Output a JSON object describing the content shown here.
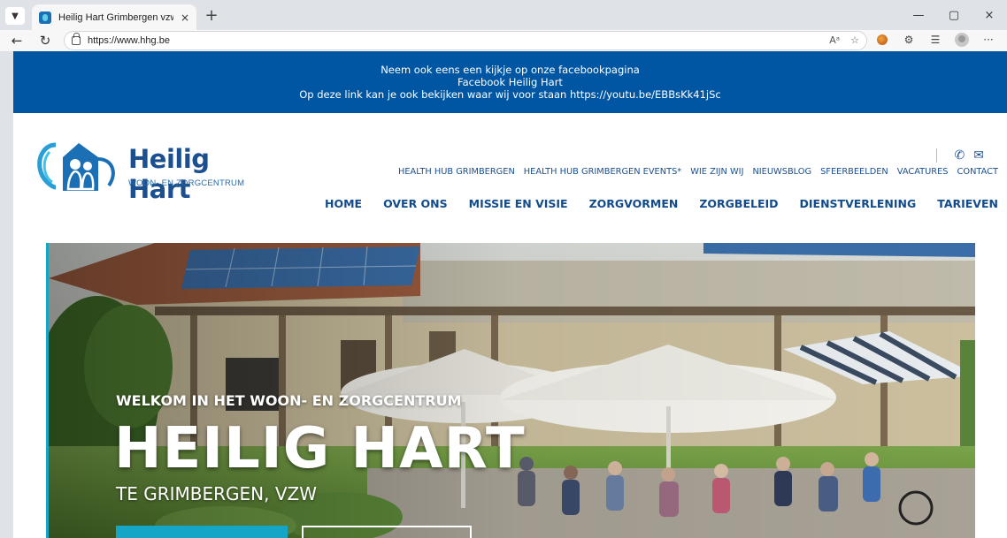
{
  "browser": {
    "tab_title": "Heilig Hart Grimbergen vzw | Wo...",
    "tab_close": "×",
    "new_tab": "+",
    "url": "https://www.hhg.be",
    "window": {
      "minimize": "—",
      "restore": "▢",
      "close": "×"
    },
    "read_aloud": "Aᵃ",
    "more": "···"
  },
  "banner": {
    "line1": "Neem ook eens een kijkje op onze facebookpagina",
    "line2": "Facebook Heilig Hart",
    "line3": "Op deze link kan je ook bekijken waar wij voor staan https://youtu.be/EBBsKk41jSc"
  },
  "logo": {
    "name": "Heilig Hart",
    "subtitle": "WOON- EN ZORGCENTRUM"
  },
  "contact_icons": {
    "phone": "✆",
    "mail": "✉"
  },
  "top_menu": [
    "HEALTH HUB GRIMBERGEN",
    "HEALTH HUB GRIMBERGEN EVENTS*",
    "WIE ZIJN WIJ",
    "NIEUWSBLOG",
    "SFEERBEELDEN",
    "VACATURES",
    "CONTACT"
  ],
  "main_menu": [
    "HOME",
    "OVER ONS",
    "MISSIE EN VISIE",
    "ZORGVORMEN",
    "ZORGBELEID",
    "DIENSTVERLENING",
    "TARIEVEN"
  ],
  "hero": {
    "kicker": "WELKOM IN HET WOON- EN ZORGCENTRUM",
    "title": "HEILIG HART",
    "subtitle": "TE GRIMBERGEN, VZW"
  },
  "colors": {
    "banner": "#0056a3",
    "brand_blue": "#1b4f8f",
    "accent_teal": "#14a6c4"
  }
}
